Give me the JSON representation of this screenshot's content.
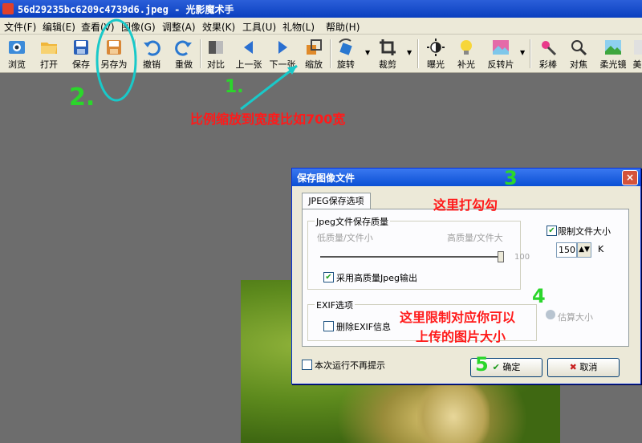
{
  "window": {
    "title": "56d29235bc6209c4739d6.jpeg - 光影魔术手"
  },
  "menu": [
    "文件(F)",
    "编辑(E)",
    "查看(V)",
    "图像(G)",
    "调整(A)",
    "效果(K)",
    "工具(U)",
    "礼物(L)",
    "帮助(H)"
  ],
  "toolbar": {
    "browse": "浏览",
    "open": "打开",
    "save": "保存",
    "save_as": "另存为",
    "undo": "撤销",
    "redo": "重做",
    "compare": "对比",
    "prev": "上一张",
    "next": "下一张",
    "resize": "缩放",
    "rotate": "旋转",
    "crop": "裁剪",
    "exposure": "曝光",
    "fill_light": "补光",
    "reverse": "反转片",
    "magic_wand": "彩棒",
    "focus": "对焦",
    "soft_focus": "柔光镜",
    "more": "美"
  },
  "annotations": {
    "step1_num": "1.",
    "step1_text": "比例缩放到宽度比如700宽",
    "step2_num": "2.",
    "step3_num": "3",
    "step3_text": "这里打勾勾",
    "step4_num": "4",
    "step4_text_line1": "这里限制对应你可以",
    "step4_text_line2": "上传的图片大小",
    "step5_num": "5"
  },
  "dialog": {
    "title": "保存图像文件",
    "close": "×",
    "tab_label": "JPEG保存选项",
    "quality_group": "Jpeg文件保存质量",
    "low_quality": "低质量/文件小",
    "high_quality": "高质量/文件大",
    "quality_max": "100",
    "quality_value": 100,
    "hq_output": "采用高质量Jpeg输出",
    "hq_output_checked": true,
    "limit_size_label": "限制文件大小",
    "limit_size_checked": true,
    "size_value": "150",
    "size_unit": "K",
    "exif_group": "EXIF选项",
    "remove_exif": "删除EXIF信息",
    "remove_exif_checked": false,
    "estimate_size": "估算大小",
    "dont_show_again": "本次运行不再提示",
    "dont_show_checked": false,
    "ok": "确定",
    "cancel": "取消"
  },
  "colors": {
    "annotation_red": "#ff1a1a",
    "annotation_green": "#2bd62b",
    "highlight_cyan": "#19c9c9",
    "title_blue": "#0a4fd4"
  }
}
